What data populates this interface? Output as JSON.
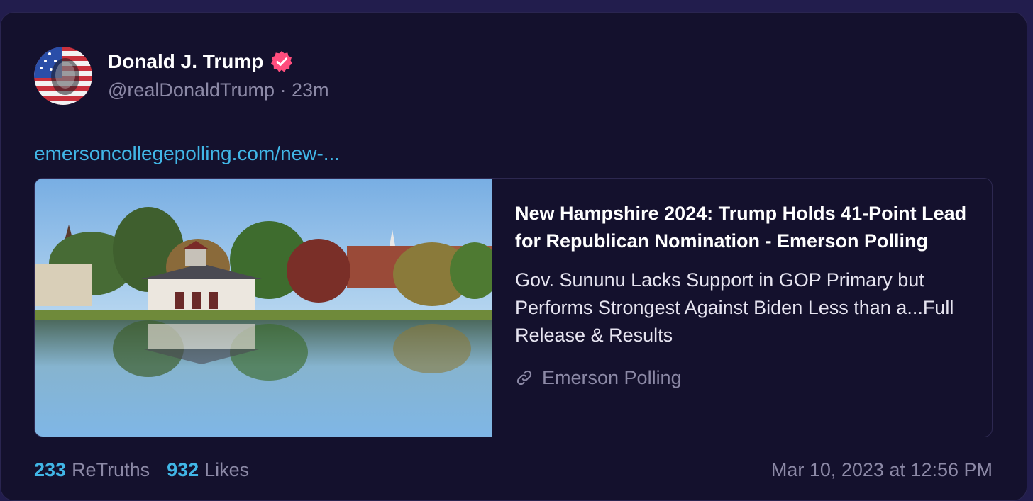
{
  "post": {
    "author": {
      "display_name": "Donald J. Trump",
      "handle": "@realDonaldTrump",
      "separator": "·",
      "time_ago": "23m",
      "verified": true
    },
    "link_text": "emersoncollegepolling.com/new-...",
    "card": {
      "title": "New Hampshire 2024: Trump Holds 41-Point Lead for Republican Nomination - Emerson Polling",
      "description": "Gov. Sununu Lacks Support in GOP Primary but Performs Strongest Against Biden Less than a...Full Release & Results",
      "source_icon": "link-icon",
      "source": "Emerson Polling"
    },
    "stats": {
      "retruths_count": "233",
      "retruths_label": "ReTruths",
      "likes_count": "932",
      "likes_label": "Likes"
    },
    "timestamp": "Mar 10, 2023 at 12:56 PM"
  },
  "colors": {
    "background": "#14112d",
    "accent_link": "#41b6e6",
    "muted_text": "#8c89a6",
    "verified_badge": "#ff4d7d"
  }
}
